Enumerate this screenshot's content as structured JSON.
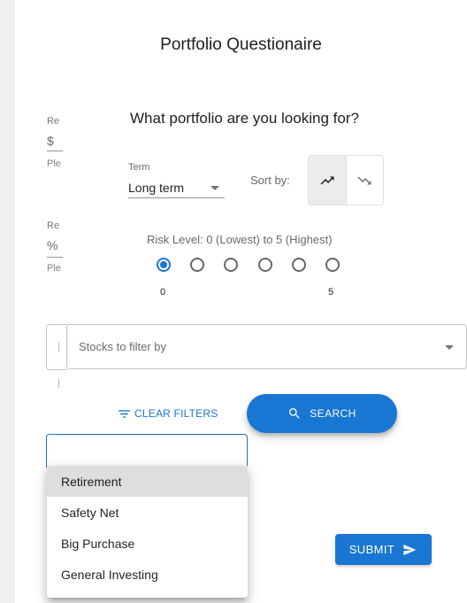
{
  "page": {
    "title": "Portfolio Questionaire"
  },
  "background_form": {
    "field1": {
      "label": "Re",
      "adornment": "$",
      "helper": "Ple"
    },
    "field2": {
      "label": "Re",
      "adornment": "%",
      "helper": "Ple"
    }
  },
  "dialog": {
    "question": "What portfolio are you looking for?",
    "term": {
      "label": "Term",
      "value": "Long term"
    },
    "sort_by": {
      "label": "Sort by:",
      "options": [
        {
          "icon": "trending-up-icon",
          "selected": true
        },
        {
          "icon": "trending-down-icon",
          "selected": false
        }
      ]
    },
    "risk": {
      "label": "Risk Level: 0 (Lowest) to 5 (Highest)",
      "levels": [
        0,
        1,
        2,
        3,
        4,
        5
      ],
      "selected": 0,
      "min_label": "0",
      "max_label": "5"
    },
    "stocks_filter": {
      "placeholder": "Stocks to filter by"
    },
    "clear_filters_label": "CLEAR FILTERS",
    "search_label": "SEARCH"
  },
  "goal_menu": {
    "items": [
      "Retirement",
      "Safety Net",
      "Big Purchase",
      "General Investing"
    ],
    "highlighted_index": 0
  },
  "submit_label": "SUBMIT",
  "colors": {
    "primary": "#1976d2",
    "page_bg": "#f1efed",
    "menu_hover": "#dedede"
  }
}
